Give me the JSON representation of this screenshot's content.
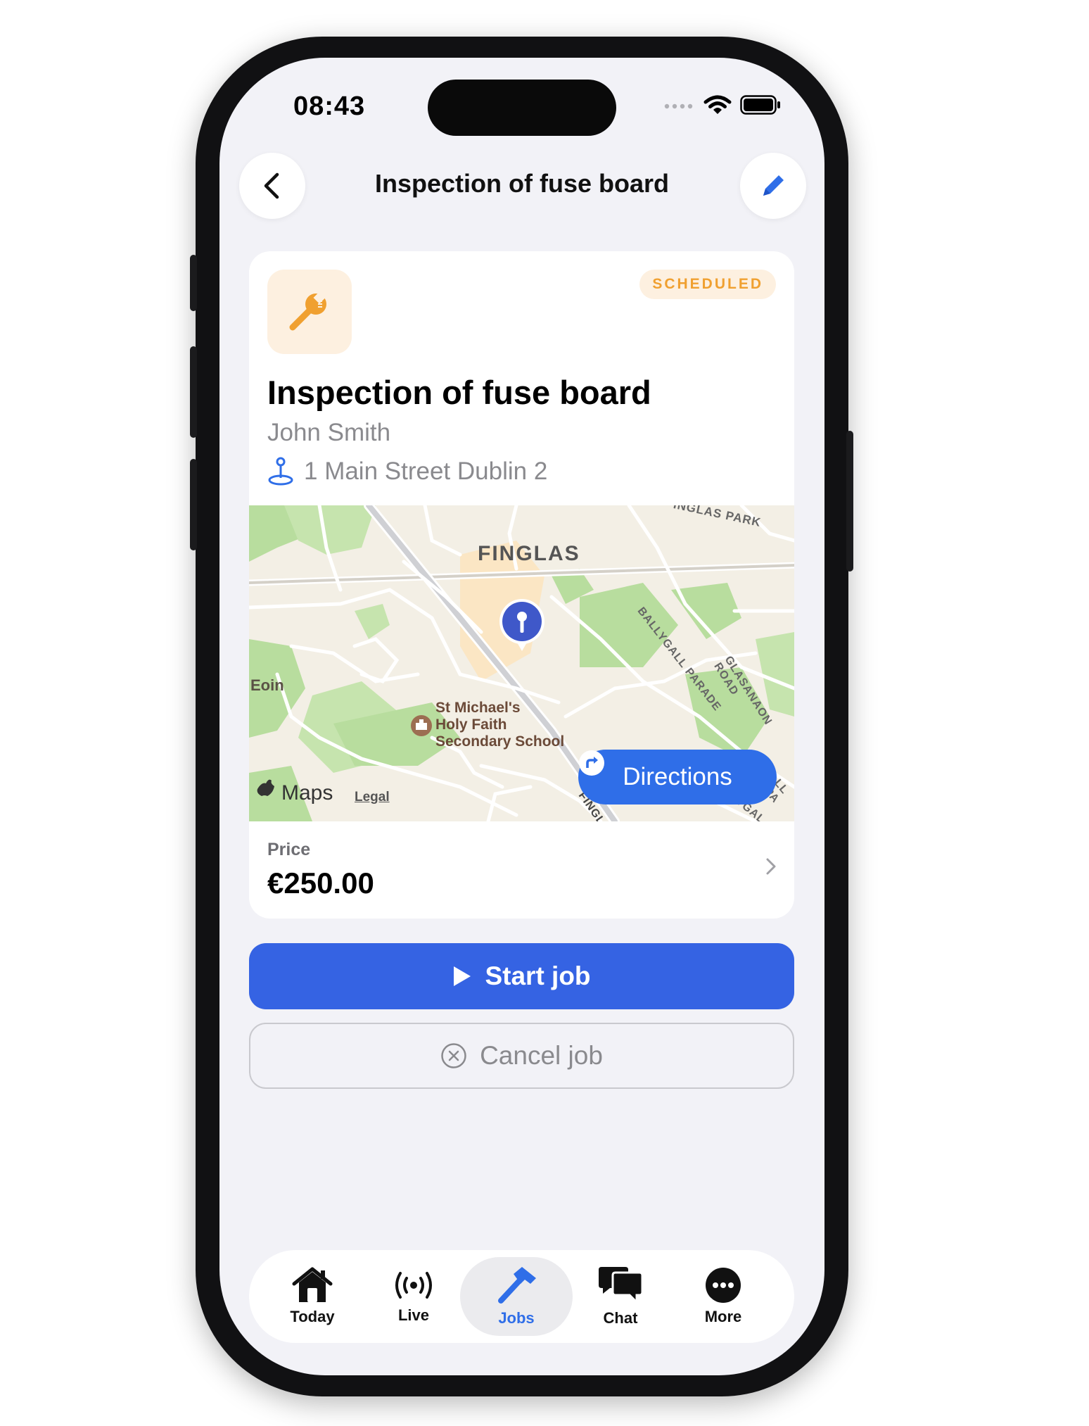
{
  "status_bar": {
    "time": "08:43"
  },
  "header": {
    "title": "Inspection of fuse board"
  },
  "job": {
    "status": "SCHEDULED",
    "title": "Inspection of fuse board",
    "customer": "John Smith",
    "address": "1 Main Street Dublin 2"
  },
  "map": {
    "labels": {
      "area": "FINGLAS",
      "park": "INGLAS PARK",
      "eoin": "Eoin",
      "school_1": "St Michael's",
      "school_2": "Holy Faith",
      "school_3": "Secondary School",
      "road_1": "BALLYGALL PARADE",
      "road_2": "GLASANAON ROAD",
      "road_3": "FINGL",
      "road_4": "YGAL",
      "road_5": "LL PA",
      "maps": "Maps",
      "legal": "Legal"
    },
    "directions_label": "Directions"
  },
  "price": {
    "label": "Price",
    "value": "€250.00"
  },
  "actions": {
    "start_label": "Start job",
    "cancel_label": "Cancel job"
  },
  "tabs": [
    {
      "label": "Today",
      "icon": "house-icon"
    },
    {
      "label": "Live",
      "icon": "broadcast-icon"
    },
    {
      "label": "Jobs",
      "icon": "hammer-icon",
      "active": true
    },
    {
      "label": "Chat",
      "icon": "chat-bubbles-icon"
    },
    {
      "label": "More",
      "icon": "more-icon"
    }
  ],
  "colors": {
    "accent": "#3563e3",
    "badge_text": "#f0a030",
    "badge_bg": "#fdf0e0"
  }
}
